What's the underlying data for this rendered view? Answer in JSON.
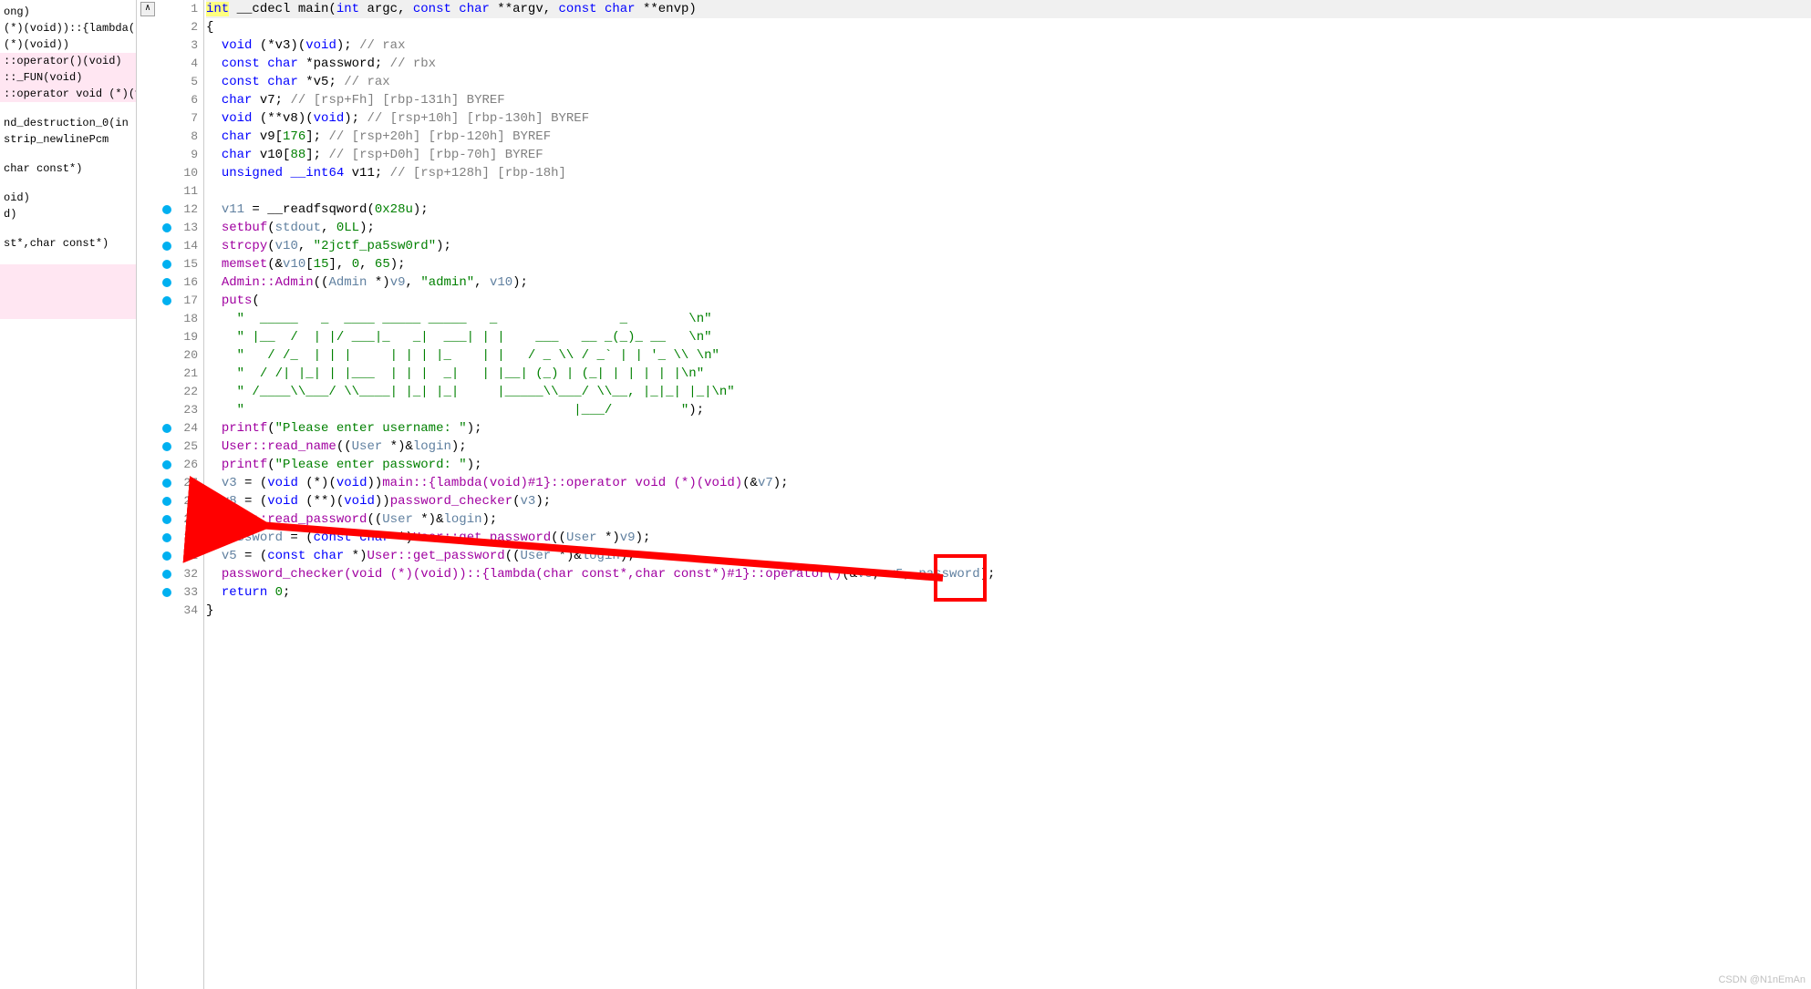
{
  "sidebar": {
    "items": [
      {
        "text": "ong)",
        "class": ""
      },
      {
        "text": "(*)(void))::{lambda(",
        "class": ""
      },
      {
        "text": " (*)(void))",
        "class": ""
      },
      {
        "text": "::operator()(void)",
        "class": "hl1"
      },
      {
        "text": "::_FUN(void)",
        "class": "hl1"
      },
      {
        "text": "::operator void (*)(vo",
        "class": "hl1"
      },
      {
        "text": "",
        "class": "spacer"
      },
      {
        "text": "nd_destruction_0(in",
        "class": ""
      },
      {
        "text": "strip_newlinePcm",
        "class": ""
      },
      {
        "text": "",
        "class": "spacer"
      },
      {
        "text": "char const*)",
        "class": ""
      },
      {
        "text": "",
        "class": "spacer"
      },
      {
        "text": "oid)",
        "class": ""
      },
      {
        "text": "d)",
        "class": ""
      },
      {
        "text": "",
        "class": "spacer"
      },
      {
        "text": "st*,char const*)",
        "class": ""
      },
      {
        "text": "",
        "class": "spacer"
      },
      {
        "text": "",
        "class": "hl1 block"
      },
      {
        "text": "",
        "class": "hl1 block"
      }
    ]
  },
  "scroll_arrow": "∧",
  "line_count": 34,
  "breakpoint_lines": [
    12,
    13,
    14,
    15,
    16,
    17,
    24,
    25,
    26,
    27,
    28,
    29,
    30,
    31,
    32,
    33
  ],
  "code": {
    "l1": {
      "pre": "",
      "int_hl": "int",
      "rest1": " __cdecl main(",
      "int2": "int",
      "rest2": " argc, ",
      "const1": "const",
      "rest3": " ",
      "char1": "char",
      "rest4": " **argv, ",
      "const2": "const",
      "rest5": " ",
      "char2": "char",
      "rest6": " **envp)"
    },
    "l2": "{",
    "l3": {
      "indent": "  ",
      "void": "void",
      "mid": " (*v3)(",
      "void2": "void",
      "after": "); ",
      "cmt": "// rax"
    },
    "l4": {
      "indent": "  ",
      "const": "const",
      "sp": " ",
      "char": "char",
      "mid": " *password; ",
      "cmt": "// rbx"
    },
    "l5": {
      "indent": "  ",
      "const": "const",
      "sp": " ",
      "char": "char",
      "mid": " *v5; ",
      "cmt": "// rax"
    },
    "l6": {
      "indent": "  ",
      "char": "char",
      "mid": " v7; ",
      "cmt": "// [rsp+Fh] [rbp-131h] BYREF"
    },
    "l7": {
      "indent": "  ",
      "void": "void",
      "mid1": " (**v8)(",
      "void2": "void",
      "mid2": "); ",
      "cmt": "// [rsp+10h] [rbp-130h] BYREF"
    },
    "l8": {
      "indent": "  ",
      "char": "char",
      "mid": " v9[",
      "num": "176",
      "mid2": "]; ",
      "cmt": "// [rsp+20h] [rbp-120h] BYREF"
    },
    "l9": {
      "indent": "  ",
      "char": "char",
      "mid": " v10[",
      "num": "88",
      "mid2": "]; ",
      "cmt": "// [rsp+D0h] [rbp-70h] BYREF"
    },
    "l10": {
      "indent": "  ",
      "unsigned": "unsigned",
      "sp": " ",
      "int64": "__int64",
      "mid": " v11; ",
      "cmt": "// [rsp+128h] [rbp-18h]"
    },
    "l11": "",
    "l12": {
      "indent": "  ",
      "var": "v11",
      "mid": " = __readfsqword(",
      "num": "0x28u",
      "end": ");"
    },
    "l13": {
      "indent": "  ",
      "func": "setbuf",
      "open": "(",
      "var": "stdout",
      "mid": ", ",
      "num": "0LL",
      "end": ");"
    },
    "l14": {
      "indent": "  ",
      "func": "strcpy",
      "open": "(",
      "var": "v10",
      "mid": ", ",
      "str": "\"2jctf_pa5sw0rd\"",
      "end": ");"
    },
    "l15": {
      "indent": "  ",
      "func": "memset",
      "open": "(&",
      "var": "v10",
      "b1": "[",
      "num1": "15",
      "b2": "], ",
      "num2": "0",
      "c": ", ",
      "num3": "65",
      "end": ");"
    },
    "l16": {
      "indent": "  ",
      "cls": "Admin::Admin",
      "open": "((",
      "type": "Admin",
      "star": " *)",
      "var1": "v9",
      "mid": ", ",
      "str": "\"admin\"",
      "c": ", ",
      "var2": "v10",
      "end": ");"
    },
    "l17": {
      "indent": "  ",
      "func": "puts",
      "open": "("
    },
    "l18": {
      "indent": "    ",
      "str": "\"  _____   _  ____ _____ _____   _                _        \\n\""
    },
    "l19": {
      "indent": "    ",
      "str": "\" |__  /  | |/ ___|_   _|  ___| | |    ___   __ _(_)_ __   \\n\""
    },
    "l20": {
      "indent": "    ",
      "str": "\"   / /_  | | |     | | | |_    | |   / _ \\\\ / _` | | '_ \\\\ \\n\""
    },
    "l21": {
      "indent": "    ",
      "str": "\"  / /| |_| | |___  | | |  _|   | |__| (_) | (_| | | | | |\\n\""
    },
    "l22": {
      "indent": "    ",
      "str": "\" /____\\\\___/ \\\\____| |_| |_|     |_____\\\\___/ \\\\__, |_|_| |_|\\n\""
    },
    "l23": {
      "indent": "    ",
      "str": "\"                                           |___/         \"",
      "end": ");"
    },
    "l24": {
      "indent": "  ",
      "func": "printf",
      "open": "(",
      "str": "\"Please enter username: \"",
      "end": ");"
    },
    "l25": {
      "indent": "  ",
      "cls": "User::read_name",
      "open": "((",
      "type": "User",
      "star": " *)&",
      "var": "login",
      "end": ");"
    },
    "l26": {
      "indent": "  ",
      "func": "printf",
      "open": "(",
      "str": "\"Please enter password: \"",
      "end": ");"
    },
    "l27": {
      "indent": "  ",
      "var": "v3",
      "eq": " = (",
      "void": "void",
      "p1": " (*)(",
      "void2": "void",
      "p2": "))",
      "lam": "main::{lambda(void)#1}::operator void (*)(void)",
      "open": "(&",
      "var2": "v7",
      "end": ");"
    },
    "l28": {
      "indent": "  ",
      "var": "v8",
      "eq": " = (",
      "void": "void",
      "p1": " (**)(",
      "void2": "void",
      "p2": "))",
      "func": "password_checker",
      "open": "(",
      "var2": "v3",
      "end": ");"
    },
    "l29": {
      "indent": "  ",
      "cls": "User::read_password",
      "open": "((",
      "type": "User",
      "star": " *)&",
      "var": "login",
      "end": ");"
    },
    "l30": {
      "indent": "  ",
      "var": "password",
      "eq": " = (",
      "const": "const",
      "sp": " ",
      "char": "char",
      "star": " *)",
      "cls": "User::get_password",
      "open": "((",
      "type": "User",
      "star2": " *)",
      "var2": "v9",
      "end": ");"
    },
    "l31": {
      "indent": "  ",
      "var": "v5",
      "eq": " = (",
      "const": "const",
      "sp": " ",
      "char": "char",
      "star": " *)",
      "cls": "User::get_password",
      "open": "((",
      "type": "User",
      "star2": " *)&",
      "var2": "login",
      "end": ");"
    },
    "l32": {
      "indent": "  ",
      "lam": "password_checker(void (*)(void))::{lambda(char const*,char const*)#1}::operator()",
      "open": "(&",
      "var1": "v8",
      "c1": ", ",
      "var2": "v5",
      "c2": ", ",
      "var3": "password",
      "end": ");"
    },
    "l33": {
      "indent": "  ",
      "ret": "return",
      "sp": " ",
      "num": "0",
      "end": ";"
    },
    "l34": "}"
  },
  "watermark": "CSDN @N1nEmAn"
}
